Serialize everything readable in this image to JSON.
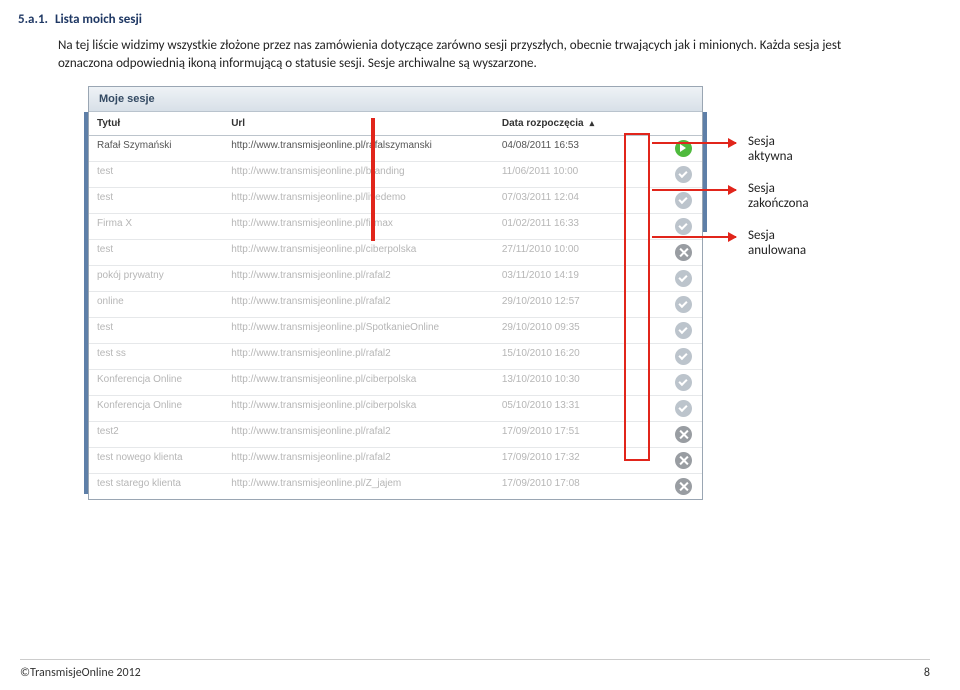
{
  "section": {
    "num": "5.a.1.",
    "title": "Lista moich sesji"
  },
  "body": "Na tej liście widzimy wszystkie złożone przez nas zamówienia dotyczące zarówno sesji przyszłych, obecnie trwających jak i minionych. Każda sesja jest oznaczona odpowiednią ikoną informującą o statusie sesji. Sesje archiwalne są wyszarzone.",
  "app": {
    "header": "Moje sesje",
    "cols": {
      "title": "Tytuł",
      "url": "Url",
      "date": "Data rozpoczęcia"
    },
    "rows": [
      {
        "title": "Rafał Szymański",
        "url": "http://www.transmisjeonline.pl/rafalszymanski",
        "date": "04/08/2011 16:53",
        "status": "active",
        "archived": false
      },
      {
        "title": "test",
        "url": "http://www.transmisjeonline.pl/branding",
        "date": "11/06/2011 10:00",
        "status": "done",
        "archived": true
      },
      {
        "title": "test",
        "url": "http://www.transmisjeonline.pl/livedemo",
        "date": "07/03/2011 12:04",
        "status": "done",
        "archived": true
      },
      {
        "title": "Firma X",
        "url": "http://www.transmisjeonline.pl/firmax",
        "date": "01/02/2011 16:33",
        "status": "done",
        "archived": true
      },
      {
        "title": "test",
        "url": "http://www.transmisjeonline.pl/ciberpolska",
        "date": "27/11/2010 10:00",
        "status": "cancel",
        "archived": true
      },
      {
        "title": "pokój prywatny",
        "url": "http://www.transmisjeonline.pl/rafal2",
        "date": "03/11/2010 14:19",
        "status": "done",
        "archived": true
      },
      {
        "title": "online",
        "url": "http://www.transmisjeonline.pl/rafal2",
        "date": "29/10/2010 12:57",
        "status": "done",
        "archived": true
      },
      {
        "title": "test",
        "url": "http://www.transmisjeonline.pl/SpotkanieOnline",
        "date": "29/10/2010 09:35",
        "status": "done",
        "archived": true
      },
      {
        "title": "test ss",
        "url": "http://www.transmisjeonline.pl/rafal2",
        "date": "15/10/2010 16:20",
        "status": "done",
        "archived": true
      },
      {
        "title": "Konferencja Online",
        "url": "http://www.transmisjeonline.pl/ciberpolska",
        "date": "13/10/2010 10:30",
        "status": "done",
        "archived": true
      },
      {
        "title": "Konferencja Online",
        "url": "http://www.transmisjeonline.pl/ciberpolska",
        "date": "05/10/2010 13:31",
        "status": "done",
        "archived": true
      },
      {
        "title": "test2",
        "url": "http://www.transmisjeonline.pl/rafal2",
        "date": "17/09/2010 17:51",
        "status": "cancel",
        "archived": true
      },
      {
        "title": "test nowego klienta",
        "url": "http://www.transmisjeonline.pl/rafal2",
        "date": "17/09/2010 17:32",
        "status": "cancel",
        "archived": true
      },
      {
        "title": "test starego klienta",
        "url": "http://www.transmisjeonline.pl/Z_jajem",
        "date": "17/09/2010 17:08",
        "status": "cancel",
        "archived": true
      }
    ]
  },
  "annotations": {
    "active": "Sesja aktywna",
    "done": "Sesja zakończona",
    "cancel": "Sesja anulowana"
  },
  "footer": {
    "left": "©TransmisjeOnline 2012",
    "right": "8"
  }
}
